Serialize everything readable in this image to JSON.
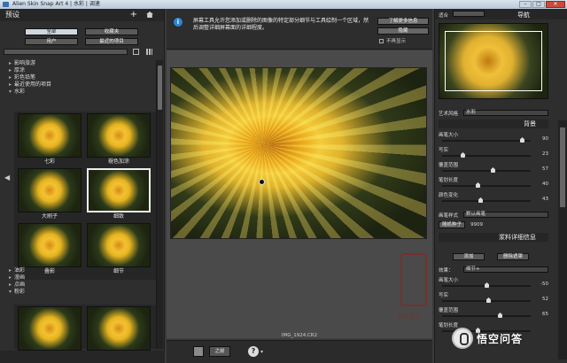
{
  "window": {
    "title": "Alien Skin Snap Art 4 | 水彩 | 调速"
  },
  "left_panel": {
    "title": "预设",
    "filters": {
      "all": "全部",
      "favorites": "收藏夹",
      "user": "用户",
      "recent": "最近的项目"
    },
    "tree_top": [
      "影响旅游",
      "厚涂",
      "彩色铅笔",
      "最近使用的项目",
      "水彩"
    ],
    "presets": [
      "七彩",
      "褪色加涂",
      "大刷子",
      "细致",
      "叠影",
      "细节"
    ],
    "tree_bottom": [
      "油彩",
      "漫画",
      "点画",
      "粉彩"
    ]
  },
  "info_bar": {
    "message": "屏幕工具允许您添加或删除的图像的特定部分细节与工具绘制一个区域，然后调整详细屏幕面的详细程度。",
    "btn_learn": "了解更多信息",
    "btn_hide": "隐藏",
    "checkbox": "不再显示"
  },
  "canvas": {
    "filename": "IMG_1924.CR2"
  },
  "toolbar": {
    "compare": "之前"
  },
  "right_panel": {
    "zoom_label": "适合",
    "nav_title": "导航",
    "art_label": "艺术风格",
    "art_value": "水彩",
    "bg_header": "背景",
    "bg_sliders": [
      {
        "name": "画笔大小",
        "value": "90",
        "level": 0.9
      },
      {
        "name": "写实",
        "value": "23",
        "level": 0.23
      },
      {
        "name": "覆盖范围",
        "value": "57",
        "level": 0.57
      },
      {
        "name": "笔划长度",
        "value": "40",
        "level": 0.4
      },
      {
        "name": "颜色变化",
        "value": "43",
        "level": 0.43
      }
    ],
    "stroke_label": "画笔样式",
    "stroke_value": "默认画笔",
    "seed_label": "随机种子",
    "seed_value": "9909",
    "detail_header": "浆料详细信息",
    "detail_btn1": "添加",
    "detail_btn2": "删除遮罩",
    "effect_label": "效果：",
    "effect_value": "细节+",
    "detail_sliders": [
      {
        "name": "画笔大小",
        "value": "-50",
        "level": 0.5
      },
      {
        "name": "写实",
        "value": "52",
        "level": 0.52
      },
      {
        "name": "覆盖范围",
        "value": "65",
        "level": 0.65
      },
      {
        "name": "笔划长度",
        "value": "",
        "level": 0.4
      }
    ]
  },
  "watermark": {
    "text": "紫枫摄影"
  },
  "brand": {
    "text": "悟空问答"
  }
}
